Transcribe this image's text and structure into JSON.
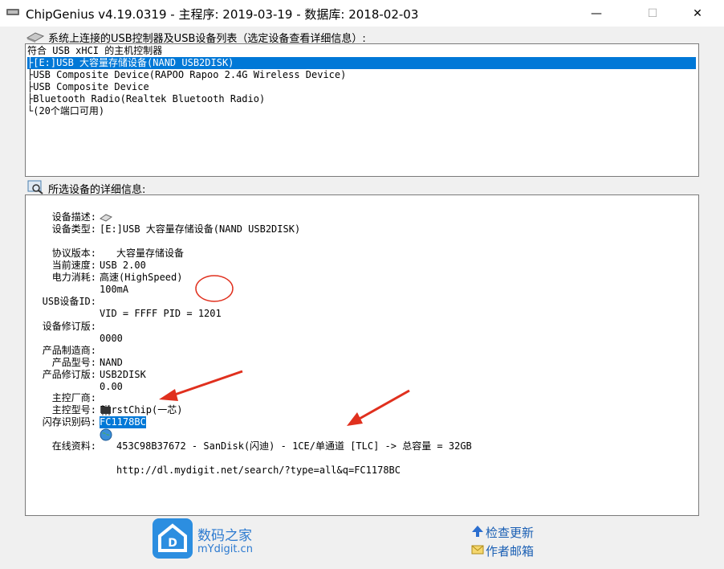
{
  "window": {
    "title": "ChipGenius v4.19.0319 - 主程序: 2019-03-19 - 数据库: 2018-02-03",
    "minimize": "—",
    "maximize": "☐",
    "close": "✕"
  },
  "device_list": {
    "label": "系统上连接的USB控制器及USB设备列表（选定设备查看详细信息）:",
    "items": [
      {
        "text": "符合 USB xHCI 的主机控制器",
        "selected": false
      },
      {
        "text": "├[E:]USB 大容量存储设备(NAND USB2DISK)",
        "selected": true
      },
      {
        "text": "├USB Composite Device(RAPOO Rapoo 2.4G Wireless Device)",
        "selected": false
      },
      {
        "text": "├USB Composite Device",
        "selected": false
      },
      {
        "text": "├Bluetooth Radio(Realtek Bluetooth Radio)",
        "selected": false
      },
      {
        "text": "└(20个端口可用)",
        "selected": false
      }
    ]
  },
  "details": {
    "label": "所选设备的详细信息:",
    "device_desc_label": "设备描述:",
    "device_desc": "[E:]USB 大容量存储设备(NAND USB2DISK)",
    "device_type_label": "设备类型:",
    "device_type": "大容量存储设备",
    "protocol_label": "协议版本:",
    "protocol": "USB 2.00",
    "speed_label": "当前速度:",
    "speed": "高速(HighSpeed)",
    "power_label": "电力消耗:",
    "power": "100mA",
    "usb_id_label": "USB设备ID:",
    "usb_id": "VID = FFFF PID = 1201",
    "revision_label": "设备修订版:",
    "revision": "0000",
    "vendor_label": "产品制造商:",
    "vendor": "NAND",
    "model_label": "产品型号:",
    "model": "USB2DISK",
    "prod_rev_label": "产品修订版:",
    "prod_rev": "0.00",
    "ctrl_vendor_label": "主控厂商:",
    "ctrl_vendor": "FirstChip(一芯)",
    "ctrl_model_label": "主控型号:",
    "ctrl_model": "FC1178BC",
    "flash_id_label": "闪存识别码:",
    "flash_id": "453C98B37672 - SanDisk(闪迪) - 1CE/单通道 [TLC] -> 总容量 = 32GB",
    "online_label": "在线资料:",
    "online_url": "http://dl.mydigit.net/search/?type=all&q=FC1178BC"
  },
  "footer": {
    "brand_cn": "数码之家",
    "brand_en": "mYdigit.cn",
    "check_update": "检查更新",
    "author_email": "作者邮箱",
    "accent": "#2c8ee0"
  }
}
